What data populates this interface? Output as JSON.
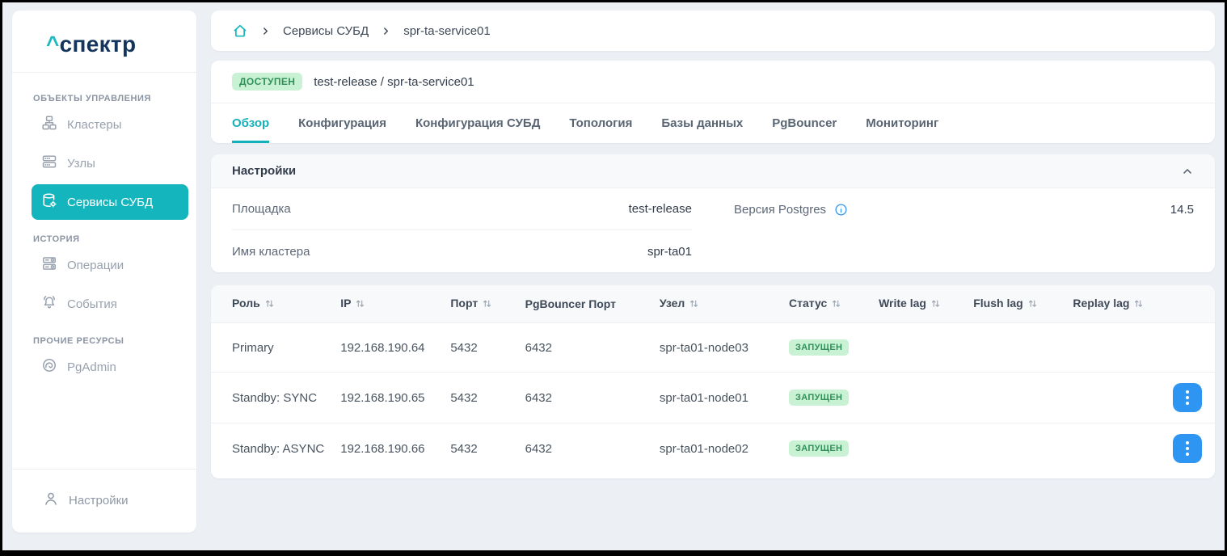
{
  "colors": {
    "accent_teal": "#14b5bc",
    "logo_navy": "#14365c",
    "status_green_bg": "#c9f2d4",
    "status_green_text": "#31905a",
    "action_blue": "#2e96f2",
    "info_blue": "#2f96f3",
    "page_background": "#ecf0f5"
  },
  "brand": {
    "caret": "^",
    "name": "спектр"
  },
  "sidebar": {
    "sections": [
      {
        "label": "ОБЪЕКТЫ УПРАВЛЕНИЯ",
        "items": [
          {
            "label": "Кластеры",
            "icon": "cluster-icon",
            "active": false
          },
          {
            "label": "Узлы",
            "icon": "nodes-icon",
            "active": false
          },
          {
            "label": "Сервисы СУБД",
            "icon": "database-gear-icon",
            "active": true
          }
        ]
      },
      {
        "label": "ИСТОРИЯ",
        "items": [
          {
            "label": "Операции",
            "icon": "operations-icon",
            "active": false
          },
          {
            "label": "События",
            "icon": "bell-icon",
            "active": false
          }
        ]
      },
      {
        "label": "ПРОЧИЕ РЕСУРСЫ",
        "items": [
          {
            "label": "PgAdmin",
            "icon": "elephant-icon",
            "active": false
          }
        ]
      }
    ],
    "footer": {
      "label": "Настройки",
      "icon": "user-icon"
    }
  },
  "breadcrumb": {
    "home_icon": "home-icon",
    "items": [
      "Сервисы СУБД",
      "spr-ta-service01"
    ]
  },
  "service_header": {
    "status_badge": "ДОСТУПЕН",
    "title": "test-release / spr-ta-service01"
  },
  "tabs": [
    {
      "label": "Обзор",
      "active": true
    },
    {
      "label": "Конфигурация",
      "active": false
    },
    {
      "label": "Конфигурация СУБД",
      "active": false
    },
    {
      "label": "Топология",
      "active": false
    },
    {
      "label": "Базы данных",
      "active": false
    },
    {
      "label": "PgBouncer",
      "active": false
    },
    {
      "label": "Мониторинг",
      "active": false
    }
  ],
  "settings": {
    "title": "Настройки",
    "collapse_icon": "chevron-up-icon",
    "rows": [
      {
        "label": "Площадка",
        "value": "test-release"
      },
      {
        "label": "Версия Postgres",
        "value": "14.5",
        "info_icon": true
      },
      {
        "label": "Имя кластера",
        "value": "spr-ta01"
      }
    ]
  },
  "table": {
    "columns": [
      {
        "label": "Роль",
        "sortable": true
      },
      {
        "label": "IP",
        "sortable": true
      },
      {
        "label": "Порт",
        "sortable": true
      },
      {
        "label": "PgBouncer Порт",
        "sortable": false
      },
      {
        "label": "Узел",
        "sortable": true
      },
      {
        "label": "Статус",
        "sortable": true
      },
      {
        "label": "Write lag",
        "sortable": true
      },
      {
        "label": "Flush lag",
        "sortable": true
      },
      {
        "label": "Replay lag",
        "sortable": true
      }
    ],
    "rows": [
      {
        "role": "Primary",
        "ip": "192.168.190.64",
        "port": "5432",
        "pgbouncer_port": "6432",
        "node": "spr-ta01-node03",
        "status": "ЗАПУЩЕН",
        "write_lag": "",
        "flush_lag": "",
        "replay_lag": "",
        "has_actions": false
      },
      {
        "role": "Standby: SYNC",
        "ip": "192.168.190.65",
        "port": "5432",
        "pgbouncer_port": "6432",
        "node": "spr-ta01-node01",
        "status": "ЗАПУЩЕН",
        "write_lag": "",
        "flush_lag": "",
        "replay_lag": "",
        "has_actions": true
      },
      {
        "role": "Standby: ASYNC",
        "ip": "192.168.190.66",
        "port": "5432",
        "pgbouncer_port": "6432",
        "node": "spr-ta01-node02",
        "status": "ЗАПУЩЕН",
        "write_lag": "",
        "flush_lag": "",
        "replay_lag": "",
        "has_actions": true
      }
    ]
  }
}
